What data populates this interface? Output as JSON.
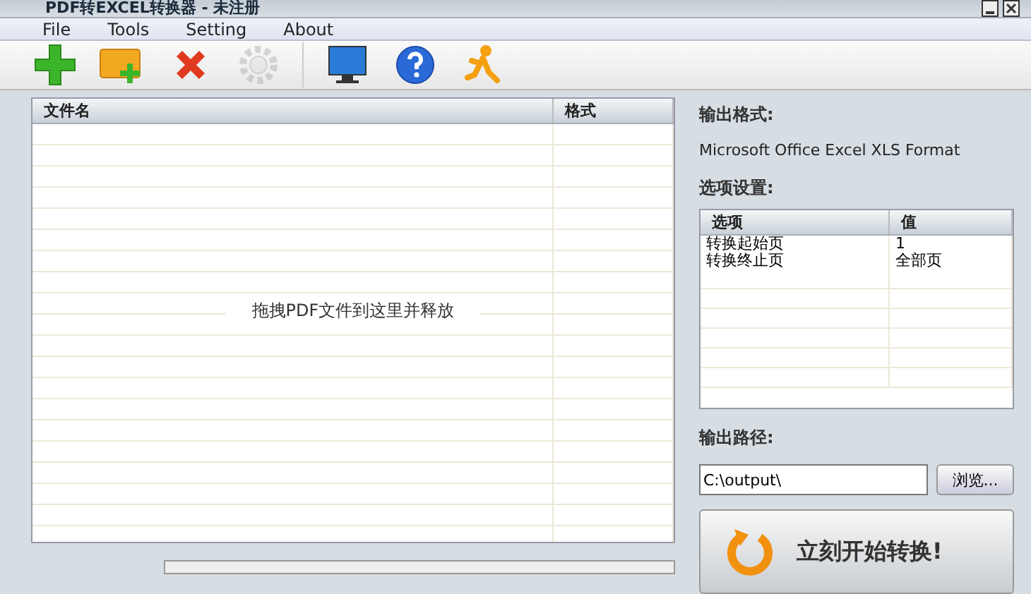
{
  "window": {
    "title": "PDF转EXCEL转换器 - 未注册"
  },
  "menu": [
    "File",
    "Tools",
    "Setting",
    "About"
  ],
  "toolbar": [
    {
      "kind": "add"
    },
    {
      "kind": "add-folder"
    },
    {
      "kind": "remove"
    },
    {
      "kind": "settings"
    },
    {
      "kind": "separator"
    },
    {
      "kind": "monitor"
    },
    {
      "kind": "help"
    },
    {
      "kind": "runner"
    }
  ],
  "file_list": {
    "columns": [
      "文件名",
      "格式"
    ],
    "hint": "拖拽PDF文件到这里并释放"
  },
  "output_format": {
    "label": "输出格式:",
    "value": "Microsoft Office Excel XLS Format"
  },
  "options": {
    "label": "选项设置:",
    "columns": [
      "选项",
      "值"
    ],
    "rows": [
      {
        "name": "转换起始页",
        "value": "1"
      },
      {
        "name": "转换终止页",
        "value": "全部页"
      }
    ]
  },
  "output_path": {
    "label": "输出路径:",
    "value": "C:\\output\\",
    "browse": "浏览..."
  },
  "convert_button": "立刻开始转换!",
  "progress": {
    "level": 0
  }
}
